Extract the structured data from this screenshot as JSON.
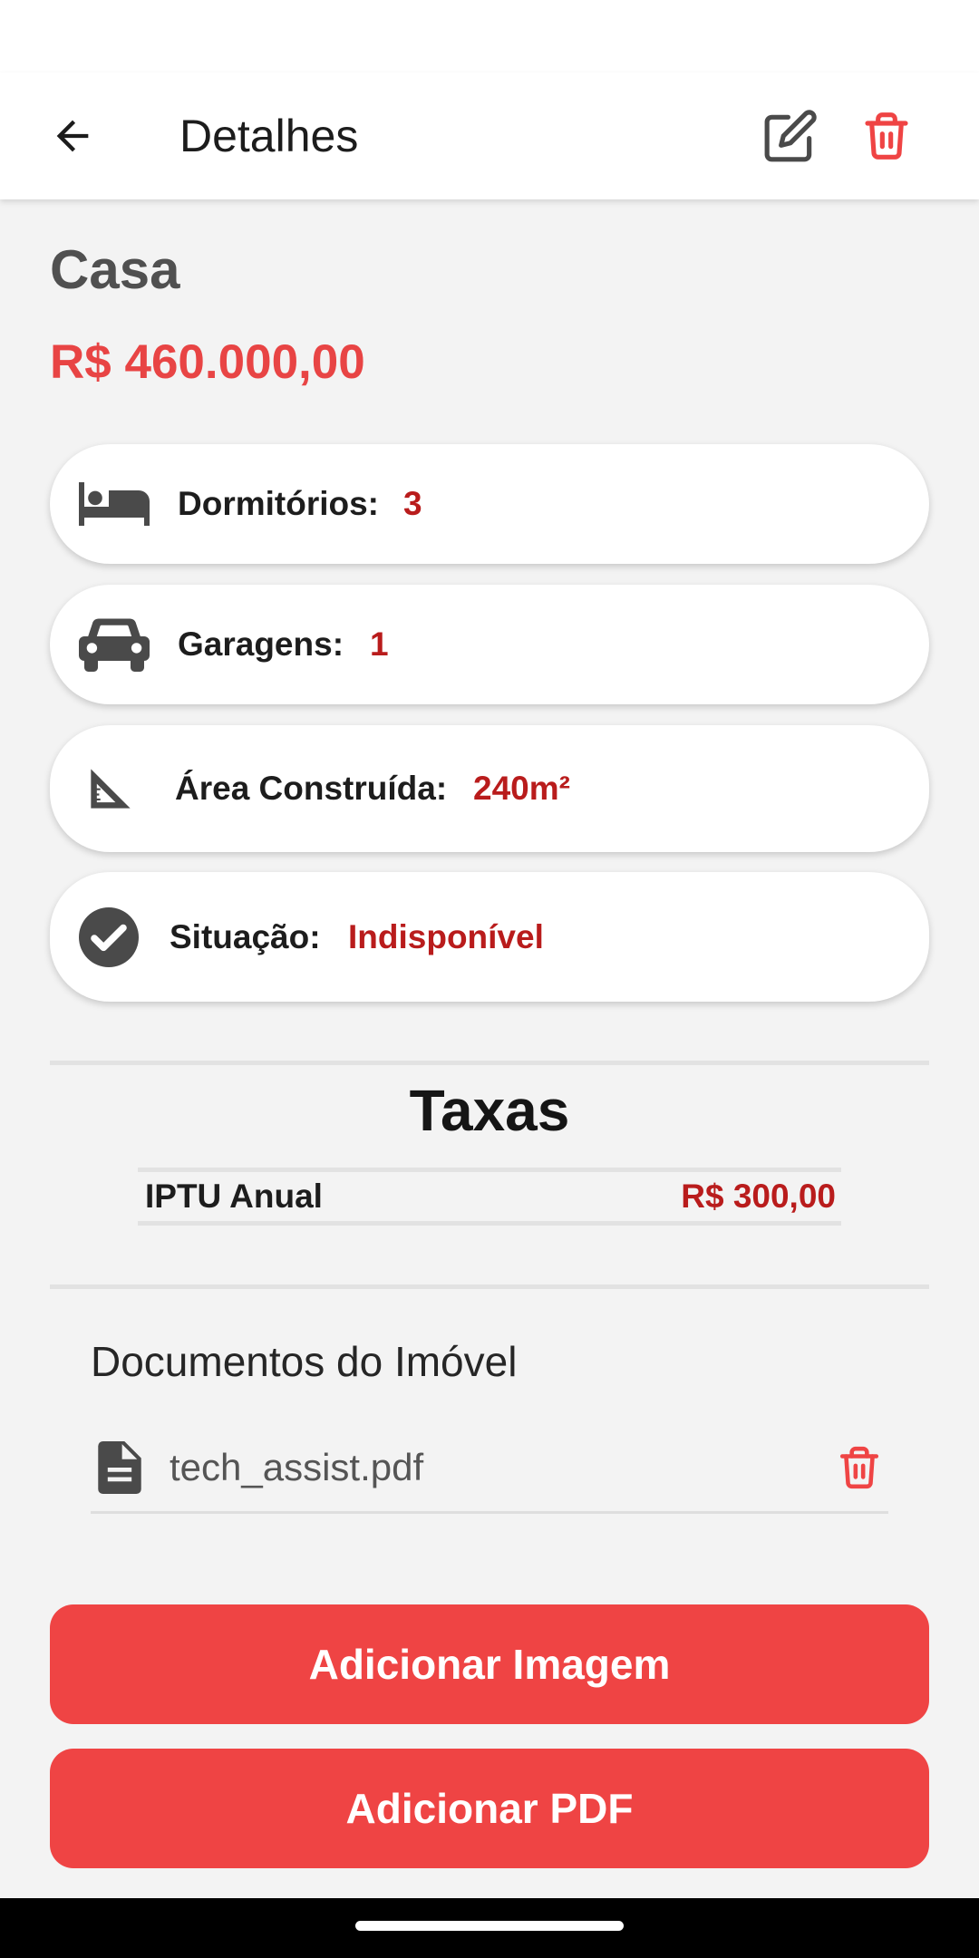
{
  "appbar": {
    "title": "Detalhes",
    "back_icon": "arrow-left-icon",
    "edit_icon": "edit-icon",
    "delete_icon": "trash-icon"
  },
  "property": {
    "title": "Casa",
    "price": "R$ 460.000,00"
  },
  "details": [
    {
      "icon": "bed-icon",
      "label": "Dormitórios:",
      "value": "3"
    },
    {
      "icon": "car-icon",
      "label": "Garagens:",
      "value": "1"
    },
    {
      "icon": "set-square-icon",
      "label": "Área Construída:",
      "value": "240m²"
    },
    {
      "icon": "check-circle-icon",
      "label": "Situação:",
      "value": "Indisponível"
    }
  ],
  "taxas": {
    "title": "Taxas",
    "items": [
      {
        "name": "IPTU Anual",
        "value": "R$ 300,00"
      }
    ]
  },
  "documents": {
    "title": "Documentos do Imóvel",
    "items": [
      {
        "icon": "file-icon",
        "name": "tech_assist.pdf",
        "delete_icon": "trash-icon"
      }
    ]
  },
  "buttons": {
    "add_image": "Adicionar Imagem",
    "add_pdf": "Adicionar PDF"
  },
  "colors": {
    "accent": "#ef4444",
    "value_red": "#b91c1c",
    "price_red": "#e84444",
    "icon_gray": "#4a4a4a"
  }
}
